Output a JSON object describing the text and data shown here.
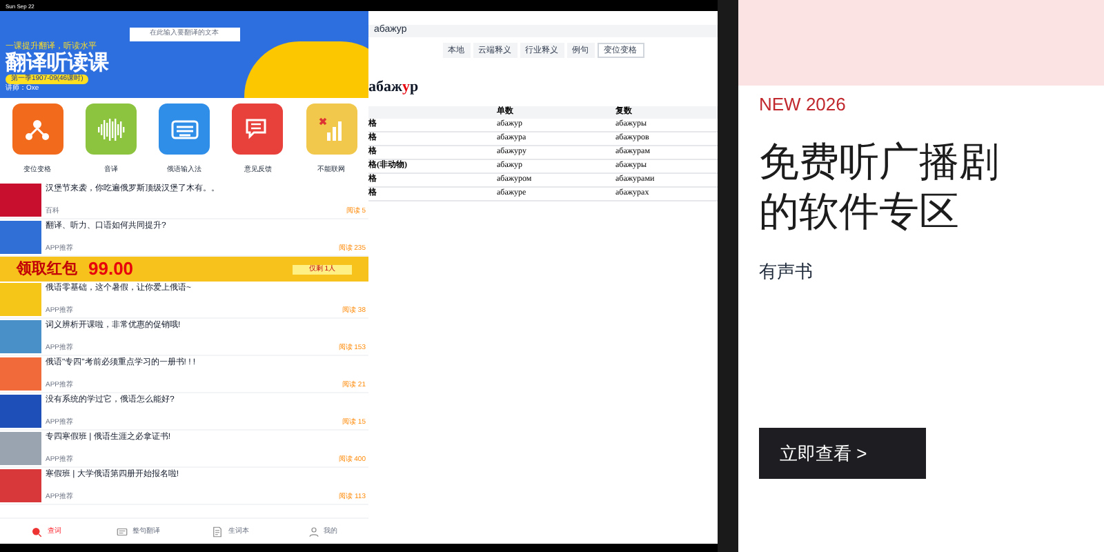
{
  "left_app": {
    "status_bar": {
      "time": "Sun Sep 22"
    },
    "search": {
      "placeholder": "在此输入要翻译的文本"
    },
    "banner": {
      "tagline": "一课提升翻译，听读水平",
      "title": "翻译听读课",
      "season": "第一季1907-09(46课时)",
      "teacher": "讲师：Oxe"
    },
    "shortcuts": [
      {
        "label": "变位变格",
        "color": "#f26b1d"
      },
      {
        "label": "音译",
        "color": "#8cc43f"
      },
      {
        "label": "俄语输入法",
        "color": "#2f8ee8"
      },
      {
        "label": "意见反馈",
        "color": "#e8403a"
      },
      {
        "label": "不能联网",
        "color": "#f1c84b"
      }
    ],
    "articles": [
      {
        "title": "汉堡节来袭，你吃遍俄罗斯顶级汉堡了木有。。",
        "tag": "百科",
        "reads": "阅读 5",
        "color": "#c8102e"
      },
      {
        "title": "翻译、听力、口语如何共同提升?",
        "tag": "APP推荐",
        "reads": "阅读 235",
        "color": "#2f6fd6"
      }
    ],
    "promo": {
      "title": "领取红包",
      "amount": "99.00",
      "note": "仅剩 1人"
    },
    "more_articles": [
      {
        "title": "俄语零基础，这个暑假，让你爱上俄语~",
        "tag": "APP推荐",
        "reads": "阅读 38",
        "color": "#f5c518"
      },
      {
        "title": "词义辨析开课啦，非常优惠的促销哦!",
        "tag": "APP推荐",
        "reads": "阅读 153",
        "color": "#4a90c8"
      },
      {
        "title": "俄语\"专四\"考前必须重点学习的一册书! ! !",
        "tag": "APP推荐",
        "reads": "阅读 21",
        "color": "#f06a3a"
      },
      {
        "title": "没有系统的学过它，俄语怎么能好?",
        "tag": "APP推荐",
        "reads": "阅读 15",
        "color": "#1e4fb8"
      },
      {
        "title": "专四寒假班 | 俄语生涯之必拿证书!",
        "tag": "APP推荐",
        "reads": "阅读 400",
        "color": "#9aa4b0"
      },
      {
        "title": "寒假班 | 大学俄语第四册开始报名啦!",
        "tag": "APP推荐",
        "reads": "阅读 113",
        "color": "#d9383a"
      }
    ],
    "tabs": [
      {
        "label": "查词",
        "selected": true
      },
      {
        "label": "整句翻译",
        "selected": false
      },
      {
        "label": "生词本",
        "selected": false
      },
      {
        "label": "我的",
        "selected": false
      }
    ]
  },
  "dictionary_app": {
    "search": {
      "value": "абажур"
    },
    "segments": [
      {
        "label": "本地",
        "selected": false
      },
      {
        "label": "云端释义",
        "selected": false
      },
      {
        "label": "行业释义",
        "selected": false
      },
      {
        "label": "例句",
        "selected": false
      },
      {
        "label": "变位变格",
        "selected": true
      }
    ],
    "headword": {
      "before": "абаж",
      "stress": "у",
      "after": "р"
    },
    "table": {
      "columns": [
        "",
        "单数",
        "复数"
      ],
      "rows": [
        [
          "格",
          "абажур",
          "абажуры"
        ],
        [
          "格",
          "абажура",
          "абажуров"
        ],
        [
          "格",
          "абажуру",
          "абажурам"
        ],
        [
          "格(非动物)",
          "абажур",
          "абажуры"
        ],
        [
          "格",
          "абажуром",
          "абажурами"
        ],
        [
          "格",
          "абажуре",
          "абажурах"
        ]
      ]
    }
  },
  "promo_panel": {
    "badge": "NEW 2026",
    "title": "免费听广播剧的软件专区",
    "subtitle": "有声书",
    "button": "立即查看 >"
  }
}
